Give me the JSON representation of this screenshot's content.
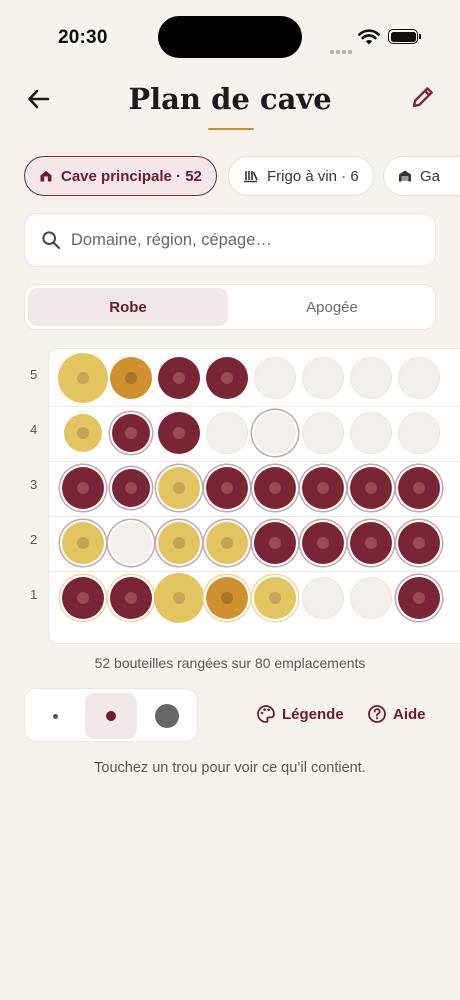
{
  "status_bar": {
    "time": "20:30"
  },
  "header": {
    "title": "Plan de cave",
    "accent": "#c9902c"
  },
  "locations": [
    {
      "label": "Cave principale · 52",
      "icon": "house-icon",
      "active": true
    },
    {
      "label": "Frigo à vin · 6",
      "icon": "wine-fridge-icon",
      "active": false
    },
    {
      "label": "Ga",
      "icon": "garage-icon",
      "active": false
    }
  ],
  "search": {
    "placeholder": "Domaine, région, cépage…",
    "value": ""
  },
  "view_toggle": {
    "options": [
      "Robe",
      "Apogée"
    ],
    "selected": "Robe"
  },
  "rack": {
    "rows_labels": [
      "5",
      "4",
      "3",
      "2",
      "1"
    ],
    "capacity": 80,
    "stored": 52,
    "colors": {
      "red": "#7a2535",
      "white": "#e2c460",
      "amber": "#cf9130",
      "empty": "#f3efea"
    },
    "rows": [
      {
        "row": "5",
        "slots": [
          "white-L",
          "amber-M",
          "red-M",
          "red-M",
          "empty-M",
          "empty-M",
          "empty-M",
          "empty-M"
        ]
      },
      {
        "row": "4",
        "slots": [
          "white-S",
          "red-S-ring",
          "red-M",
          "empty-M",
          "empty-M-ring",
          "empty-M",
          "empty-M",
          "empty-M"
        ]
      },
      {
        "row": "3",
        "slots": [
          "red-M-ring",
          "red-S-ring",
          "white-M-ring",
          "red-M-ring",
          "red-M-ring",
          "red-M-ring",
          "red-M-ring",
          "red-M-ring"
        ]
      },
      {
        "row": "2",
        "slots": [
          "white-M-ring",
          "empty-M-ring",
          "white-M-ring",
          "white-M-ring",
          "red-M-ring",
          "red-M-ring",
          "red-M-ring",
          "red-M-ring"
        ]
      },
      {
        "row": "1",
        "slots": [
          "red-M-gold",
          "red-M-gold",
          "white-L",
          "amber-M-gold",
          "white-M-gold",
          "empty-M",
          "empty-M",
          "red-M-ring"
        ]
      }
    ]
  },
  "rack_caption": "52 bouteilles rangées sur 80 emplacements",
  "size_selector": {
    "options": [
      "small",
      "medium",
      "large"
    ],
    "selected": "medium"
  },
  "actions": {
    "legend_label": "Légende",
    "help_label": "Aide"
  },
  "hint": "Touchez un trou pour voir ce qu’il contient."
}
